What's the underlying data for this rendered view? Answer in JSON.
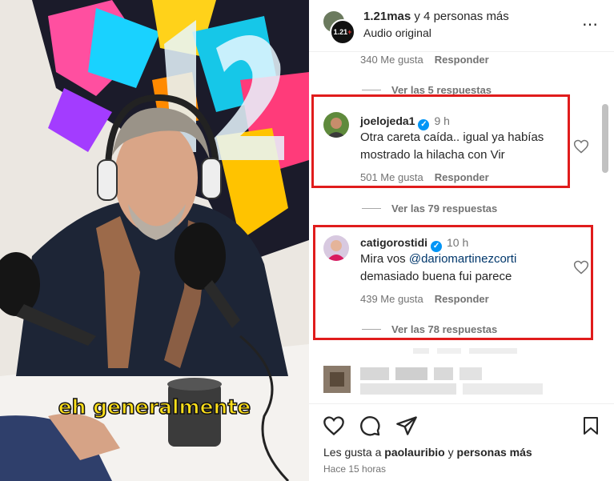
{
  "video": {
    "subtitle": "eh generalmente"
  },
  "header": {
    "title_user": "1.21mas",
    "title_rest": " y 4 personas más",
    "subtitle": "Audio original",
    "avatar_badge": "1.21",
    "avatar_badge_plus": "+",
    "more_icon": "⋯"
  },
  "comments": {
    "top_meta": {
      "likes": "340 Me gusta",
      "reply": "Responder"
    },
    "top_view": "Ver las 5 respuestas",
    "c1": {
      "user": "joelojeda1",
      "time": "9 h",
      "text": "Otra careta caída.. igual ya habías mostrado la hilacha con Vir",
      "likes": "501 Me gusta",
      "reply": "Responder",
      "view": "Ver las 79 respuestas"
    },
    "c2": {
      "user": "catigorostidi",
      "time": "10 h",
      "text_pre": "Mira vos ",
      "mention": "@dariomartinezcorti",
      "text_post": "demasiado buena fui parece",
      "likes": "439 Me gusta",
      "reply": "Responder",
      "view": "Ver las 78 respuestas"
    },
    "verified_icon": "✓"
  },
  "footer": {
    "likes_pre": "Les gusta a ",
    "likes_user": "paolauribio",
    "likes_mid": " y ",
    "likes_rest": "personas más",
    "time": "Hace 15 horas"
  },
  "colors": {
    "highlight": "#e01c1c",
    "verified": "#0095f6",
    "subtitle": "#ffe01a"
  }
}
